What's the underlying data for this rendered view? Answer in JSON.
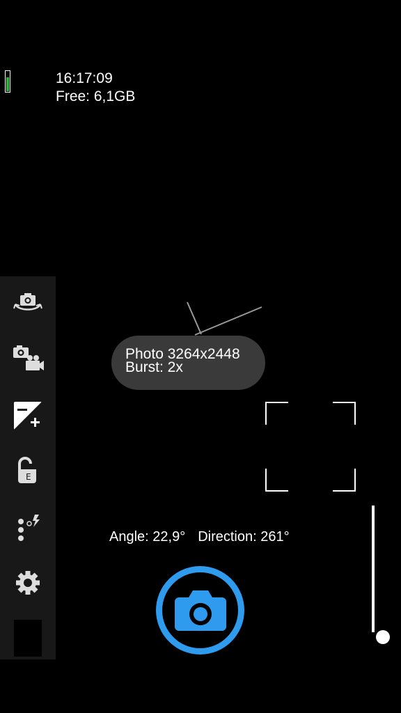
{
  "status": {
    "time": "16:17:09",
    "free_storage": "Free: 6,1GB",
    "battery_level": 0.7,
    "battery_color": "#22bb33"
  },
  "sidebar": {
    "items": [
      {
        "icon": "switch-camera-icon"
      },
      {
        "icon": "photo-video-mode-icon"
      },
      {
        "icon": "exposure-compensation-icon"
      },
      {
        "icon": "exposure-lock-icon"
      },
      {
        "icon": "popup-menu-icon"
      },
      {
        "icon": "settings-gear-icon"
      }
    ],
    "gallery_thumbnail": "gallery-thumbnail"
  },
  "toast": {
    "line1": "Photo 3264x2448",
    "line2": "Burst: 2x"
  },
  "orientation": {
    "angle": "Angle: 22,9°",
    "direction": "Direction: 261°"
  },
  "shutter": {
    "icon": "camera-shutter-icon",
    "accent": "#2f9bef"
  }
}
